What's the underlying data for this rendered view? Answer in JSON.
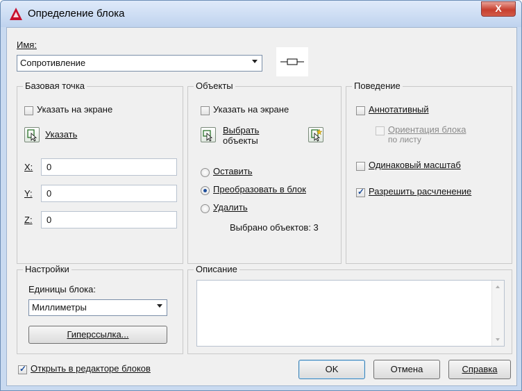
{
  "window": {
    "title": "Определение блока",
    "close": "X"
  },
  "name": {
    "label": "Имя:",
    "value": "Сопротивление",
    "preview_icon": "resistor-symbol-icon"
  },
  "base_point": {
    "title": "Базовая точка",
    "specify_on_screen": "Указать на экране",
    "pick_button": "Указать",
    "x_label": "X:",
    "x_value": "0",
    "y_label": "Y:",
    "y_value": "0",
    "z_label": "Z:",
    "z_value": "0"
  },
  "objects": {
    "title": "Объекты",
    "specify_on_screen": "Указать на экране",
    "select_line1": "Выбрать",
    "select_line2": "объекты",
    "retain": "Оставить",
    "convert": "Преобразовать в блок",
    "delete": "Удалить",
    "selected_count": "Выбрано объектов: 3"
  },
  "behavior": {
    "title": "Поведение",
    "annotative": "Аннотативный",
    "orient_line1": "Ориентация блока",
    "orient_line2": "по листу",
    "uniform_scale": "Одинаковый масштаб",
    "allow_explode": "Разрешить расчленение"
  },
  "settings": {
    "title": "Настройки",
    "units_label": "Единицы блока:",
    "units_value": "Миллиметры",
    "hyperlink_button": "Гиперссылка..."
  },
  "description": {
    "title": "Описание",
    "value": ""
  },
  "footer": {
    "open_in_editor": "Открыть в редакторе блоков",
    "ok": "OK",
    "cancel": "Отмена",
    "help": "Справка"
  }
}
